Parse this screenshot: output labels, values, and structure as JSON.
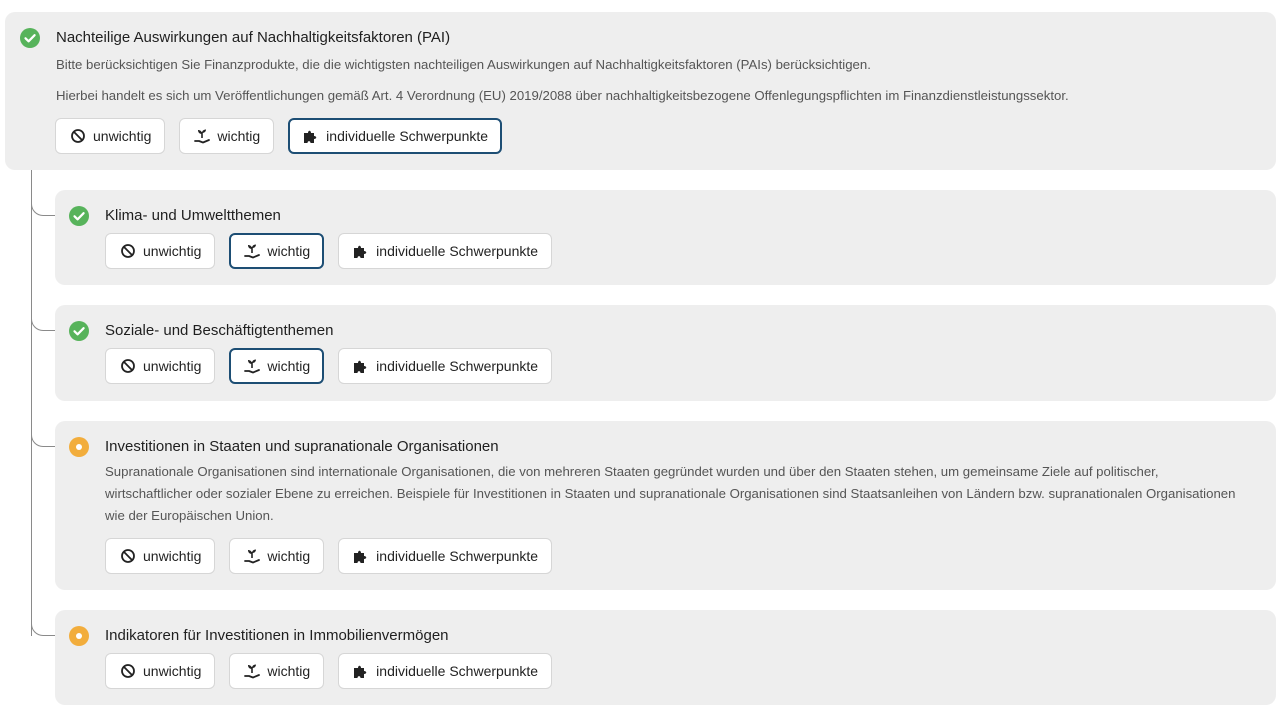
{
  "options": {
    "unwichtig": "unwichtig",
    "wichtig": "wichtig",
    "individuell": "individuelle Schwerpunkte"
  },
  "main": {
    "title": "Nachteilige Auswirkungen auf Nachhaltigkeitsfaktoren (PAI)",
    "desc1": "Bitte berücksichtigen Sie Finanzprodukte, die die wichtigsten nachteiligen Auswirkungen auf Nachhaltigkeitsfaktoren (PAIs) berücksichtigen.",
    "desc2": "Hierbei handelt es sich um Veröffentlichungen gemäß Art. 4 Verordnung (EU) 2019/2088 über nachhaltigkeitsbezogene Offenlegungspflichten im Finanzdienstleistungssektor.",
    "selected": "individuell",
    "status": "done"
  },
  "sections": [
    {
      "title": "Klima- und Umweltthemen",
      "selected": "wichtig",
      "status": "done"
    },
    {
      "title": "Soziale- und Beschäftigtenthemen",
      "selected": "wichtig",
      "status": "done"
    },
    {
      "title": "Investitionen in Staaten und supranationale Organisationen",
      "desc": "Supranationale Organisationen sind internationale Organisationen, die von mehreren Staaten gegründet wurden und über den Staaten stehen, um gemeinsame Ziele auf politischer, wirtschaftlicher oder sozialer Ebene zu erreichen. Beispiele für Investitionen in Staaten und supranationale Organisationen sind Staatsanleihen von Ländern bzw. supranationalen Organisationen wie der Europäischen Union.",
      "selected": "",
      "status": "pending"
    },
    {
      "title": "Indikatoren für Investitionen in Immobilienvermögen",
      "selected": "",
      "status": "pending"
    }
  ],
  "colors": {
    "done": "#57b35b",
    "pending": "#f2ad3c",
    "selected_border": "#1d4e74",
    "card_bg": "#eeeeee"
  },
  "icons": {
    "unwichtig": "block-icon",
    "wichtig": "hand-plant-icon",
    "individuell": "puzzle-icon",
    "done": "check-circle-icon",
    "pending": "dot-circle-icon"
  }
}
